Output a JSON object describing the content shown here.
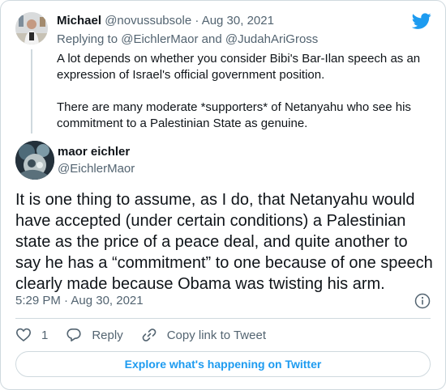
{
  "parent_tweet": {
    "author_name": "Michael",
    "author_handle": "@novussubsole",
    "separator": "·",
    "date": "Aug 30, 2021",
    "replying_prefix": "Replying to",
    "replying_to_1": "@EichlerMaor",
    "replying_and": "and",
    "replying_to_2": "@JudahAriGross",
    "paragraph_1": "A lot depends on whether you consider Bibi's Bar-Ilan speech as an expression of Israel's official government position.",
    "paragraph_2": "There are many moderate *supporters* of Netanyahu who see his commitment to a Palestinian State as genuine."
  },
  "main_tweet": {
    "author_name": "maor eichler",
    "author_handle": "@EichlerMaor",
    "text": "It is one thing to assume, as I do, that Netanyahu would have accepted (under certain conditions) a Palestinian state as the price of a peace deal, and quite another to say he has a “commitment” to one because of one speech clearly made because Obama was twisting his arm.",
    "timestamp": "5:29 PM · Aug 30, 2021"
  },
  "actions": {
    "like_count": "1",
    "reply_label": "Reply",
    "copy_link_label": "Copy link to Tweet"
  },
  "explore_button": "Explore what's happening on Twitter",
  "colors": {
    "twitter_blue": "#1d9bf0",
    "text": "#0f1419",
    "muted": "#536471",
    "border": "#cfd9de"
  },
  "icons": [
    "twitter-bird-icon",
    "info-icon",
    "heart-icon",
    "reply-bubble-icon",
    "link-icon"
  ]
}
